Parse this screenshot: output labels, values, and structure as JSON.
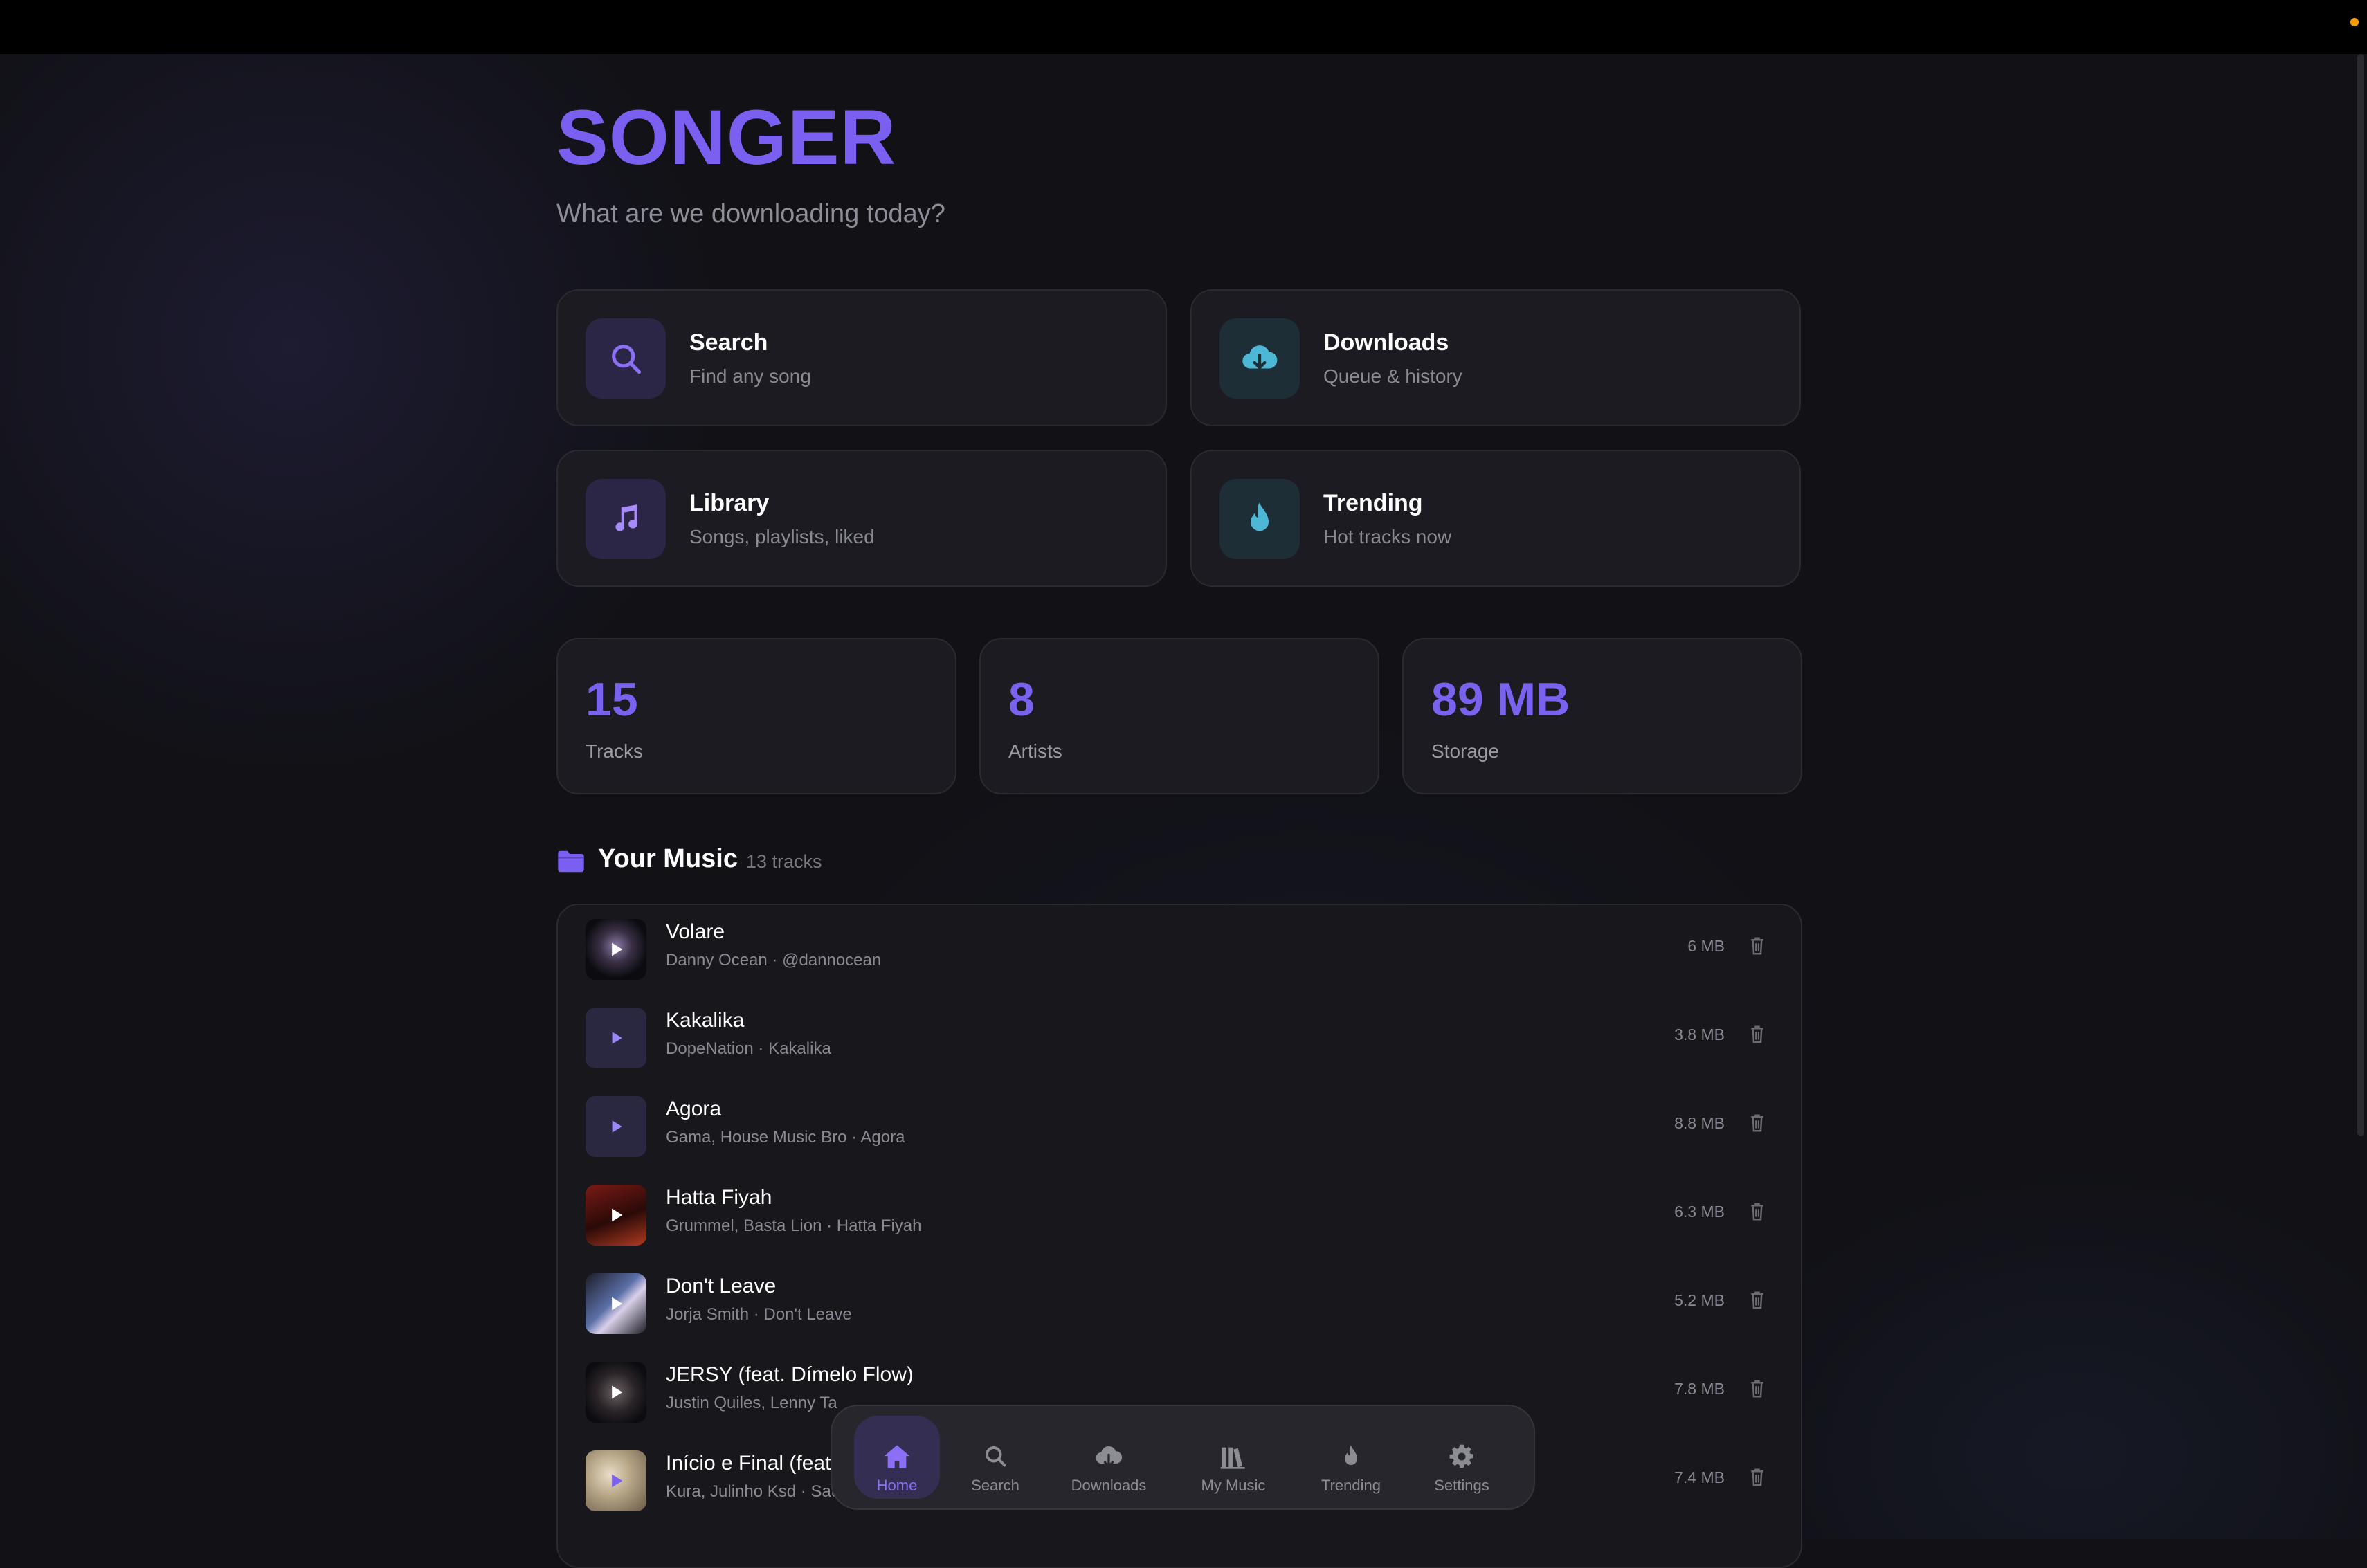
{
  "app": {
    "title": "SONGER",
    "subtitle": "What are we downloading today?"
  },
  "actions": [
    {
      "title": "Search",
      "subtitle": "Find any song",
      "icon": "search-icon"
    },
    {
      "title": "Downloads",
      "subtitle": "Queue & history",
      "icon": "cloud-download-icon"
    },
    {
      "title": "Library",
      "subtitle": "Songs, playlists, liked",
      "icon": "music-note-icon"
    },
    {
      "title": "Trending",
      "subtitle": "Hot tracks now",
      "icon": "flame-icon"
    }
  ],
  "stats": [
    {
      "value": "15",
      "label": "Tracks"
    },
    {
      "value": "8",
      "label": "Artists"
    },
    {
      "value": "89 MB",
      "label": "Storage"
    }
  ],
  "section": {
    "title": "Your Music",
    "count": "13 tracks",
    "icon": "folder-icon"
  },
  "tracks": [
    {
      "title": "Volare",
      "subtitle": "Danny Ocean · @dannocean",
      "size": "6 MB"
    },
    {
      "title": "Kakalika",
      "subtitle": "DopeNation · Kakalika",
      "size": "3.8 MB"
    },
    {
      "title": "Agora",
      "subtitle": "Gama, House Music Bro · Agora",
      "size": "8.8 MB"
    },
    {
      "title": "Hatta Fiyah",
      "subtitle": "Grummel, Basta Lion · Hatta Fiyah",
      "size": "6.3 MB"
    },
    {
      "title": "Don't Leave",
      "subtitle": "Jorja Smith · Don't Leave",
      "size": "5.2 MB"
    },
    {
      "title": "JERSY (feat. Dímelo Flow)",
      "subtitle": "Justin Quiles, Lenny Ta",
      "size": "7.8 MB"
    },
    {
      "title": "Início e Final (feat.",
      "subtitle": "Kura, Julinho Ksd · Saudade",
      "size": "7.4 MB"
    }
  ],
  "nav": [
    {
      "label": "Home",
      "icon": "home-icon",
      "active": true
    },
    {
      "label": "Search",
      "icon": "search-icon"
    },
    {
      "label": "Downloads",
      "icon": "cloud-download-icon"
    },
    {
      "label": "My Music",
      "icon": "library-icon"
    },
    {
      "label": "Trending",
      "icon": "flame-icon"
    },
    {
      "label": "Settings",
      "icon": "gear-icon"
    }
  ],
  "colors": {
    "accent": "#7b5ff0",
    "teal": "#4fb7d6",
    "background": "#111116"
  }
}
